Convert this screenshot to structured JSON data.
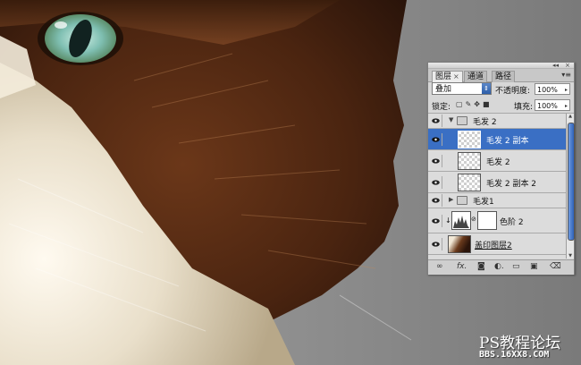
{
  "colors": {
    "selection": "#3a6fc4",
    "fur_brown": "#5a2d14",
    "fur_cream": "#efe6d2",
    "eye_iris": "#7fbfb2"
  },
  "panel": {
    "tabs": [
      {
        "label": "图层",
        "active": true,
        "close": "×"
      },
      {
        "label": "通道",
        "active": false
      },
      {
        "label": "路径",
        "active": false
      }
    ],
    "blend_mode": "叠加",
    "opacity_label": "不透明度:",
    "opacity_value": "100%",
    "lock_label": "锁定:",
    "fill_label": "填充:",
    "fill_value": "100%",
    "layers": [
      {
        "name": "毛发 2",
        "type": "group",
        "expanded": true
      },
      {
        "name": "毛发 2 副本",
        "type": "layer",
        "selected": true
      },
      {
        "name": "毛发 2",
        "type": "layer"
      },
      {
        "name": "毛发 2 副本 2",
        "type": "layer"
      },
      {
        "name": "毛发1",
        "type": "group",
        "expanded": false
      },
      {
        "name": "色阶 2",
        "type": "adjustment"
      },
      {
        "name": "盖印图层2",
        "type": "layer"
      }
    ],
    "bottom_icons": [
      "link-icon",
      "fx-icon",
      "mask-icon",
      "adjustment-icon",
      "folder-icon",
      "new-layer-icon",
      "trash-icon"
    ]
  },
  "watermark": {
    "line1": "PS教程论坛",
    "line2": "BBS.16XX8.COM"
  }
}
